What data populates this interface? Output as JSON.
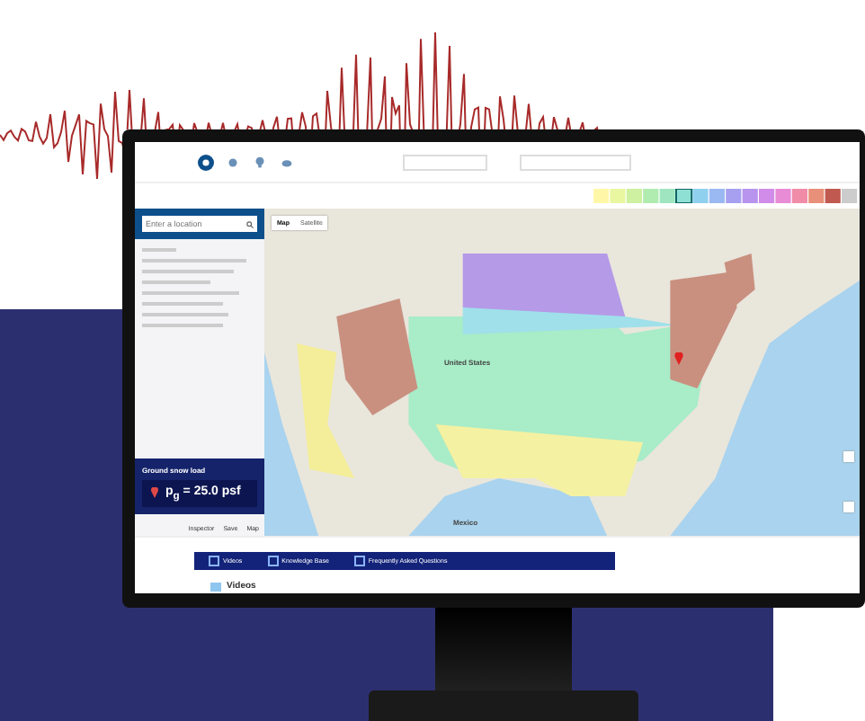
{
  "search": {
    "placeholder": "Enter a location"
  },
  "snow_card": {
    "title": "Ground snow load",
    "value": "p$_{g}$ = 25.0 psf"
  },
  "panel_tabs": [
    {
      "label": "Inspector",
      "selected": false
    },
    {
      "label": "Save",
      "selected": false
    },
    {
      "label": "Map",
      "selected": false
    }
  ],
  "map_toggle": [
    {
      "label": "Map",
      "selected": true
    },
    {
      "label": "Satellite",
      "selected": false
    }
  ],
  "map_labels": [
    "United States",
    "Mexico"
  ],
  "nav_bar": [
    "Videos",
    "Knowledge Base",
    "Frequently Asked Questions"
  ],
  "section_heading": "Videos"
}
